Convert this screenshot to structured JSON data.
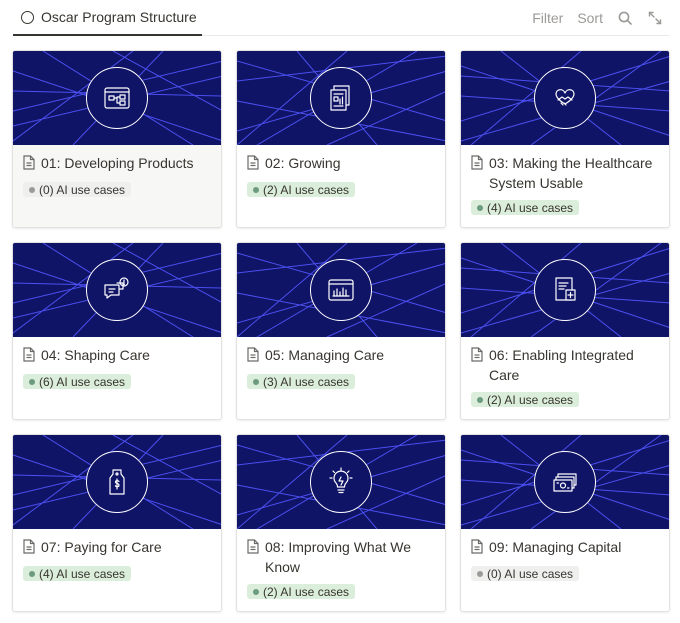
{
  "view": {
    "title": "Oscar Program Structure"
  },
  "toolbar": {
    "filter_label": "Filter",
    "sort_label": "Sort",
    "search_icon": "search-icon",
    "expand_icon": "expand-icon"
  },
  "colors": {
    "cover_bg": "#101466",
    "cover_lines": "#4a4ff0",
    "tag_green_bg": "#dbeddb",
    "tag_gray_bg": "#efefee"
  },
  "cards": [
    {
      "title": "01: Developing Products",
      "count": "(0) AI use cases",
      "tag": "gray",
      "icon": "workflow-diagram-icon"
    },
    {
      "title": "02: Growing",
      "count": "(2) AI use cases",
      "tag": "green",
      "icon": "documents-chart-icon"
    },
    {
      "title": "03: Making the Healthcare System Usable",
      "count": "(4) AI use cases",
      "tag": "green",
      "icon": "handshake-heart-icon"
    },
    {
      "title": "04: Shaping Care",
      "count": "(6) AI use cases",
      "tag": "green",
      "icon": "chat-bubbles-icon"
    },
    {
      "title": "05: Managing Care",
      "count": "(3) AI use cases",
      "tag": "green",
      "icon": "dashboard-chart-icon"
    },
    {
      "title": "06: Enabling Integrated Care",
      "count": "(2) AI use cases",
      "tag": "green",
      "icon": "medical-records-icon"
    },
    {
      "title": "07: Paying for Care",
      "count": "(4) AI use cases",
      "tag": "green",
      "icon": "dollar-tag-icon"
    },
    {
      "title": "08: Improving What We Know",
      "count": "(2) AI use cases",
      "tag": "green",
      "icon": "lightbulb-icon"
    },
    {
      "title": "09: Managing Capital",
      "count": "(0) AI use cases",
      "tag": "gray",
      "icon": "cash-stack-icon"
    }
  ]
}
